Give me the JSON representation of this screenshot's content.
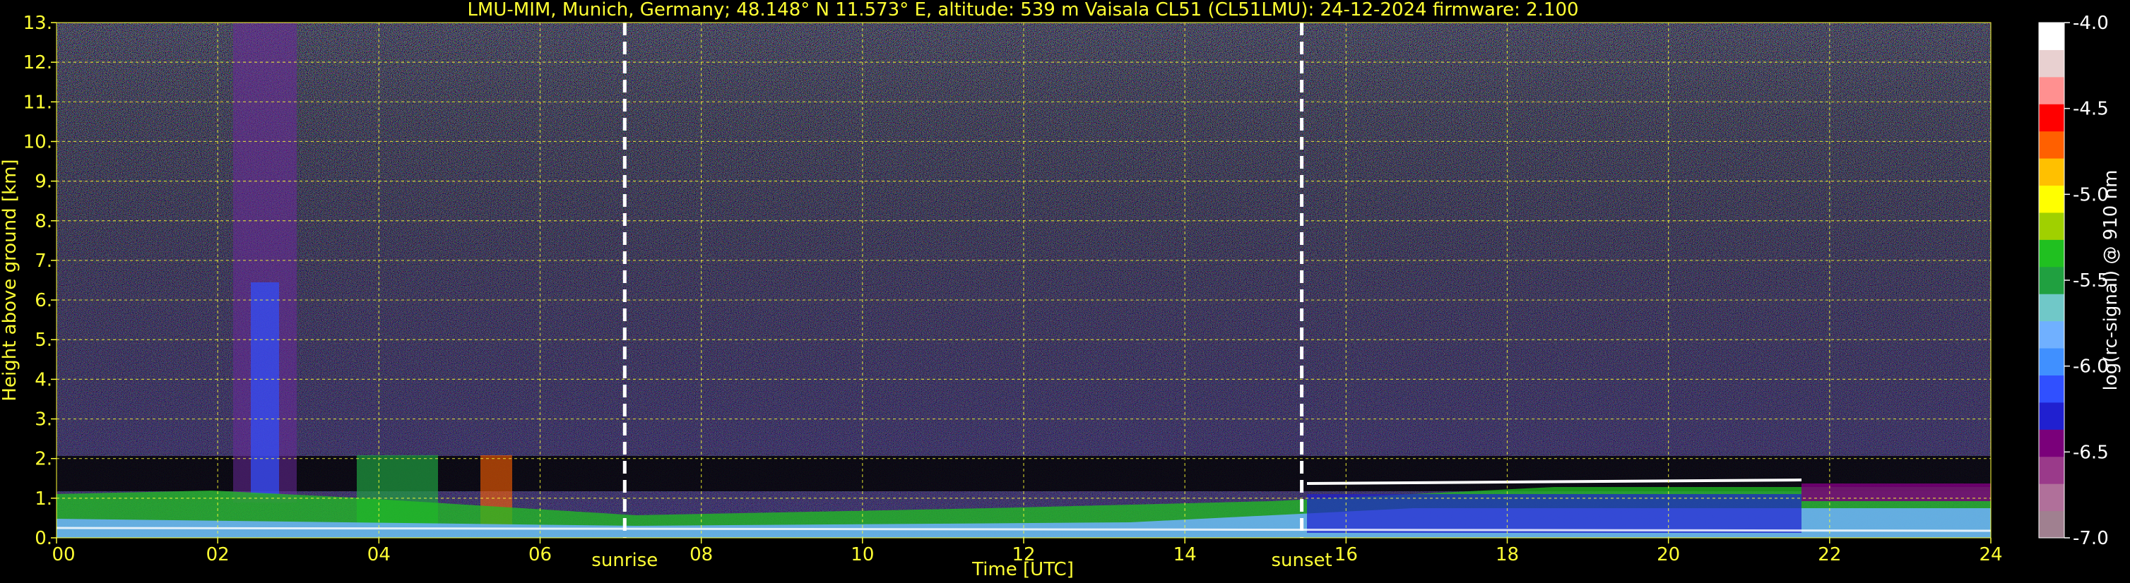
{
  "chart_data": {
    "type": "heatmap",
    "title": "LMU-MIM, Munich, Germany; 48.148° N 11.573° E, altitude: 539 m    Vaisala CL51 (CL51LMU): 24-12-2024    firmware: 2.100",
    "xlabel": "Time [UTC]",
    "ylabel": "Height above ground [km]",
    "colorbar_label": "log(rc-signal) @ 910 nm",
    "xlim": [
      0,
      24
    ],
    "ylim": [
      0,
      13
    ],
    "x_ticks": [
      "00",
      "02",
      "04",
      "06",
      "08",
      "10",
      "12",
      "14",
      "16",
      "18",
      "20",
      "22",
      "24"
    ],
    "y_ticks": [
      "0.",
      "1.",
      "2.",
      "3.",
      "4.",
      "5.",
      "6.",
      "7.",
      "8.",
      "9.",
      "10.",
      "11.",
      "12.",
      "13."
    ],
    "grid": true,
    "colorbar_range": [
      -7.0,
      -4.0
    ],
    "colorbar_ticks": [
      "-7.0",
      "-6.5",
      "-6.0",
      "-5.5",
      "-5.0",
      "-4.5",
      "-4.0"
    ],
    "colorbar_colors": [
      "#a08090",
      "#b0709a",
      "#9a3a8a",
      "#7a007a",
      "#2020d0",
      "#3050ff",
      "#4090ff",
      "#70b0ff",
      "#70c8c8",
      "#20a040",
      "#20c020",
      "#a0d000",
      "#ffff00",
      "#ffc000",
      "#ff6000",
      "#ff0000",
      "#ff9090",
      "#e8d0d0",
      "#ffffff"
    ],
    "markers": [
      {
        "label": "sunrise",
        "x": 7.05
      },
      {
        "label": "sunset",
        "x": 15.45
      }
    ]
  }
}
